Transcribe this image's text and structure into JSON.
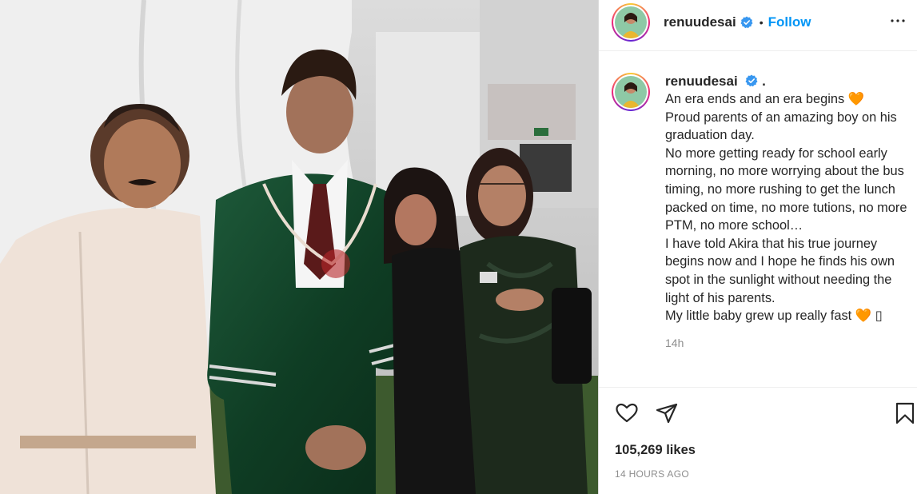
{
  "post": {
    "username": "renuudesai",
    "follow_label": "Follow",
    "separator": "•",
    "caption_suffix": ".",
    "caption": "An era ends and an era begins 🧡\nProud parents of an amazing boy on his graduation day.\nNo more getting ready for school early morning, no more worrying about the bus timing, no more rushing to get the lunch packed on time, no more tutions, no more PTM, no more school…\nI have told Akira that his true journey begins now and I hope he finds his own spot in the sunlight without needing the light of his parents.\nMy little baby grew up really fast 🧡 ▯",
    "relative_time": "14h",
    "likes": "105,269 likes",
    "timestamp": "14 HOURS AGO"
  },
  "icons": {
    "verified": "verified-badge-icon",
    "more": "more-options-icon",
    "like": "heart-icon",
    "share": "paper-plane-icon",
    "save": "bookmark-icon"
  },
  "colors": {
    "follow": "#0095f6",
    "verified": "#3897f0",
    "heart": "#f26c2e",
    "secondary_text": "#8e8e8e"
  }
}
